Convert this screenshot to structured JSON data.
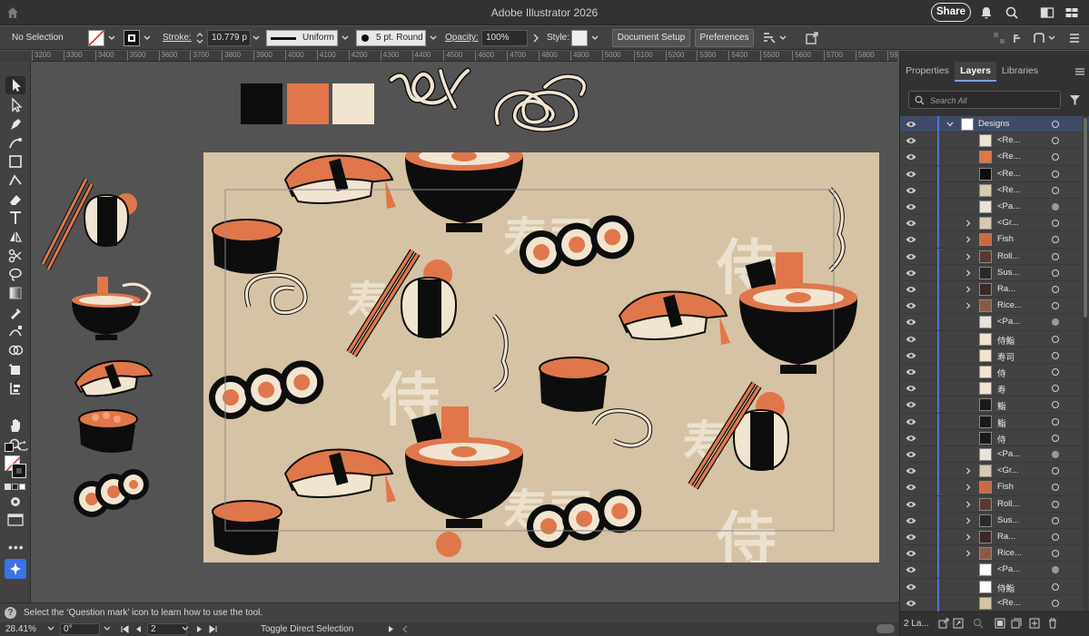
{
  "titlebar": {
    "app_title": "Adobe Illustrator 2026",
    "share_label": "Share"
  },
  "controlbar": {
    "selection": "No Selection",
    "stroke_label": "Stroke:",
    "stroke_value": "10.779 p",
    "profile_value": "Uniform",
    "brush_value": "5 pt. Round",
    "opacity_label": "Opacity:",
    "opacity_value": "100%",
    "style_label": "Style:",
    "document_setup_label": "Document Setup",
    "preferences_label": "Preferences"
  },
  "ruler": {
    "ticks": [
      "3200",
      "3300",
      "3400",
      "3500",
      "3600",
      "3700",
      "3800",
      "3900",
      "4000",
      "4100",
      "4200",
      "4300",
      "4400",
      "4500",
      "4600",
      "4700",
      "4800",
      "4900",
      "5000",
      "5100",
      "5200",
      "5300",
      "5400",
      "5500",
      "5600",
      "5700",
      "5800",
      "590"
    ]
  },
  "toolbar": {
    "tools": [
      "selection-tool",
      "direct-selection-tool",
      "pen-tool",
      "curvature-tool",
      "rectangle-tool",
      "shaper-tool",
      "eraser-tool",
      "type-tool",
      "reflect-tool",
      "scissors-tool",
      "lasso-tool",
      "gradient-tool",
      "eyedropper-tool",
      "blend-tool",
      "shape-builder-tool",
      "artboard-tool",
      "slice-tool",
      "hand-tool",
      "zoom-tool"
    ]
  },
  "swatches": {
    "colors": [
      "#0d0d0d",
      "#e0774a",
      "#f1e4d1"
    ]
  },
  "artboard": {
    "background": "#d6c3a5",
    "kanji_sushi": "寿司",
    "kanji_samurai": "侍",
    "kanji_sushi_single": "寿"
  },
  "status": {
    "help_text": "Select the ‘Question mark’ icon to learn how to use the tool.",
    "zoom": "28.41%",
    "rotation": "0°",
    "artboard_number": "2",
    "tool_hint": "Toggle Direct Selection"
  },
  "panel": {
    "tabs": [
      "Properties",
      "Layers",
      "Libraries"
    ],
    "active_tab": "Layers",
    "search_placeholder": "Search All",
    "layer_count": "2 La...",
    "layers": [
      {
        "name": "Designs",
        "group": true,
        "twirl": "open",
        "thumb": "#ffffff",
        "target": "open"
      },
      {
        "name": "<Re...",
        "twirl": "",
        "thumb": "#f1e4d1",
        "target": "open"
      },
      {
        "name": "<Re...",
        "twirl": "",
        "thumb": "#e0774a",
        "target": "open"
      },
      {
        "name": "<Re...",
        "twirl": "",
        "thumb": "#0d0d0d",
        "target": "open"
      },
      {
        "name": "<Re...",
        "twirl": "",
        "thumb": "#d9c8b0",
        "target": "open"
      },
      {
        "name": "<Pa...",
        "twirl": "",
        "thumb": "#e8e2d8",
        "target": "filled"
      },
      {
        "name": "<Gr...",
        "twirl": "closed",
        "thumb": "#d9c8b0",
        "target": "open"
      },
      {
        "name": "Fish",
        "twirl": "closed",
        "thumb": "#c96a45",
        "target": "open"
      },
      {
        "name": "Roll...",
        "twirl": "closed",
        "thumb": "#5a3a30",
        "target": "open"
      },
      {
        "name": "Sus...",
        "twirl": "closed",
        "thumb": "#2a2a2a",
        "target": "open"
      },
      {
        "name": "Ra...",
        "twirl": "closed",
        "thumb": "#3a2a25",
        "target": "open"
      },
      {
        "name": "Rice...",
        "twirl": "closed",
        "thumb": "#8a5a45",
        "target": "open"
      },
      {
        "name": "<Pa...",
        "twirl": "",
        "thumb": "#e8e2d8",
        "target": "filled"
      },
      {
        "name": "侍鮨",
        "twirl": "",
        "thumb": "#f1e4d1",
        "target": "open"
      },
      {
        "name": "寿司",
        "twirl": "",
        "thumb": "#f1e4d1",
        "target": "open"
      },
      {
        "name": "侍",
        "twirl": "",
        "thumb": "#f1e4d1",
        "target": "open"
      },
      {
        "name": "寿",
        "twirl": "",
        "thumb": "#f1e4d1",
        "target": "open"
      },
      {
        "name": "鮨",
        "twirl": "",
        "thumb": "#1a1a1a",
        "target": "open"
      },
      {
        "name": "鮨",
        "twirl": "",
        "thumb": "#1a1a1a",
        "target": "open"
      },
      {
        "name": "侍",
        "twirl": "",
        "thumb": "#1a1a1a",
        "target": "open"
      },
      {
        "name": "<Pa...",
        "twirl": "",
        "thumb": "#e8e2d8",
        "target": "filled"
      },
      {
        "name": "<Gr...",
        "twirl": "closed",
        "thumb": "#d9c8b0",
        "target": "open"
      },
      {
        "name": "Fish",
        "twirl": "closed",
        "thumb": "#c96a45",
        "target": "open"
      },
      {
        "name": "Roll...",
        "twirl": "closed",
        "thumb": "#5a3a30",
        "target": "open"
      },
      {
        "name": "Sus...",
        "twirl": "closed",
        "thumb": "#2a2a2a",
        "target": "open"
      },
      {
        "name": "Ra...",
        "twirl": "closed",
        "thumb": "#3a2a25",
        "target": "open"
      },
      {
        "name": "Rice...",
        "twirl": "closed",
        "thumb": "#8a5a45",
        "target": "open"
      },
      {
        "name": "<Pa...",
        "twirl": "",
        "thumb": "#ffffff",
        "target": "filled"
      },
      {
        "name": "侍鮨",
        "twirl": "",
        "thumb": "#ffffff",
        "target": "open"
      },
      {
        "name": "<Re...",
        "twirl": "",
        "thumb": "#d6c3a5",
        "target": "open"
      }
    ]
  }
}
